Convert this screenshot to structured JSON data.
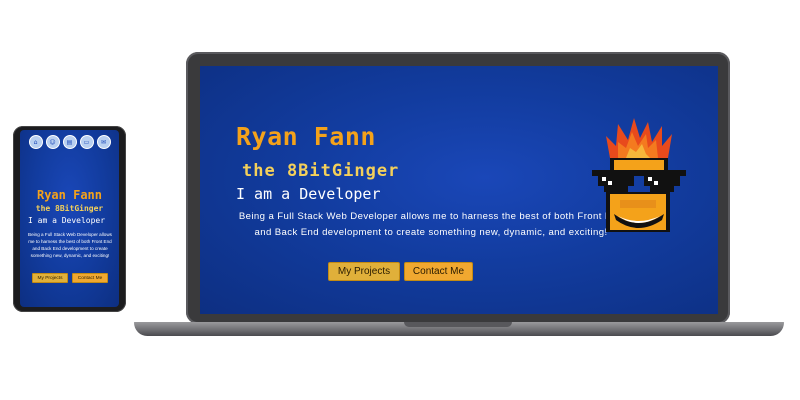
{
  "hero": {
    "name": "Ryan Fann",
    "handle": "the 8BitGinger",
    "role": "I am a Developer",
    "description": "Being a Full Stack Web Developer allows me to harness the best of both Front End and Back End development to create something new, dynamic, and exciting!",
    "projects_button": "My Projects",
    "contact_button": "Contact Me"
  },
  "mobile_nav": {
    "icons": [
      "home-icon",
      "user-icon",
      "folder-icon",
      "document-icon",
      "mail-icon"
    ]
  },
  "colors": {
    "background_blue": "#123c9f",
    "title_orange": "#f4a21a",
    "handle_yellow": "#f4d05a",
    "button_gold": "#e0b03a",
    "mascot_flame": "#e84a1c"
  }
}
